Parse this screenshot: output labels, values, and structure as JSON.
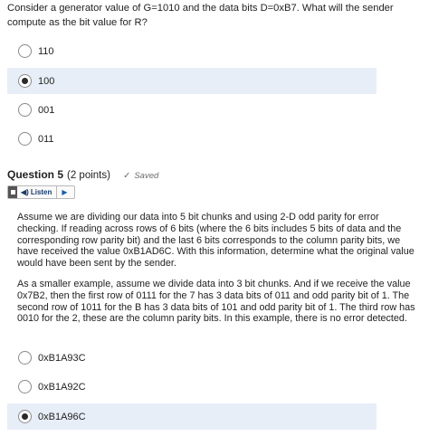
{
  "question4": {
    "text": "Consider a generator value of G=1010 and the data bits D=0xB7. What will the sender compute as the bit value for R?",
    "options": [
      {
        "label": "110",
        "selected": false
      },
      {
        "label": "100",
        "selected": true
      },
      {
        "label": "001",
        "selected": false
      },
      {
        "label": "011",
        "selected": false
      }
    ]
  },
  "question5": {
    "title": "Question 5",
    "points": "(2 points)",
    "saved_label": "Saved",
    "listen_label": "Listen",
    "paragraph1": "Assume we are dividing our data into 5 bit chunks and using 2-D odd parity for error checking. If reading across rows of 6 bits (where the 6 bits includes 5 bits of data and the corresponding row parity bit) and the last 6 bits corresponds to the column parity bits, we have received the value 0xB1AD6C. With this information, determine what the original value would have been sent by the sender.",
    "paragraph2": "As a smaller example, assume we divide data into 3 bit chunks. And if we receive the value 0x7B2, then the first row of 0111 for the 7 has 3 data bits of 011 and odd parity bit of 1. The second row of 1011 for the B has 3 data bits of 101 and odd parity bit of 1. The third row has 0010 for the 2, these are the column parity bits. In this example, there is no error detected.",
    "options": [
      {
        "label": "0xB1A93C",
        "selected": false
      },
      {
        "label": "0xB1A92C",
        "selected": false
      },
      {
        "label": "0xB1A96C",
        "selected": true
      }
    ]
  }
}
